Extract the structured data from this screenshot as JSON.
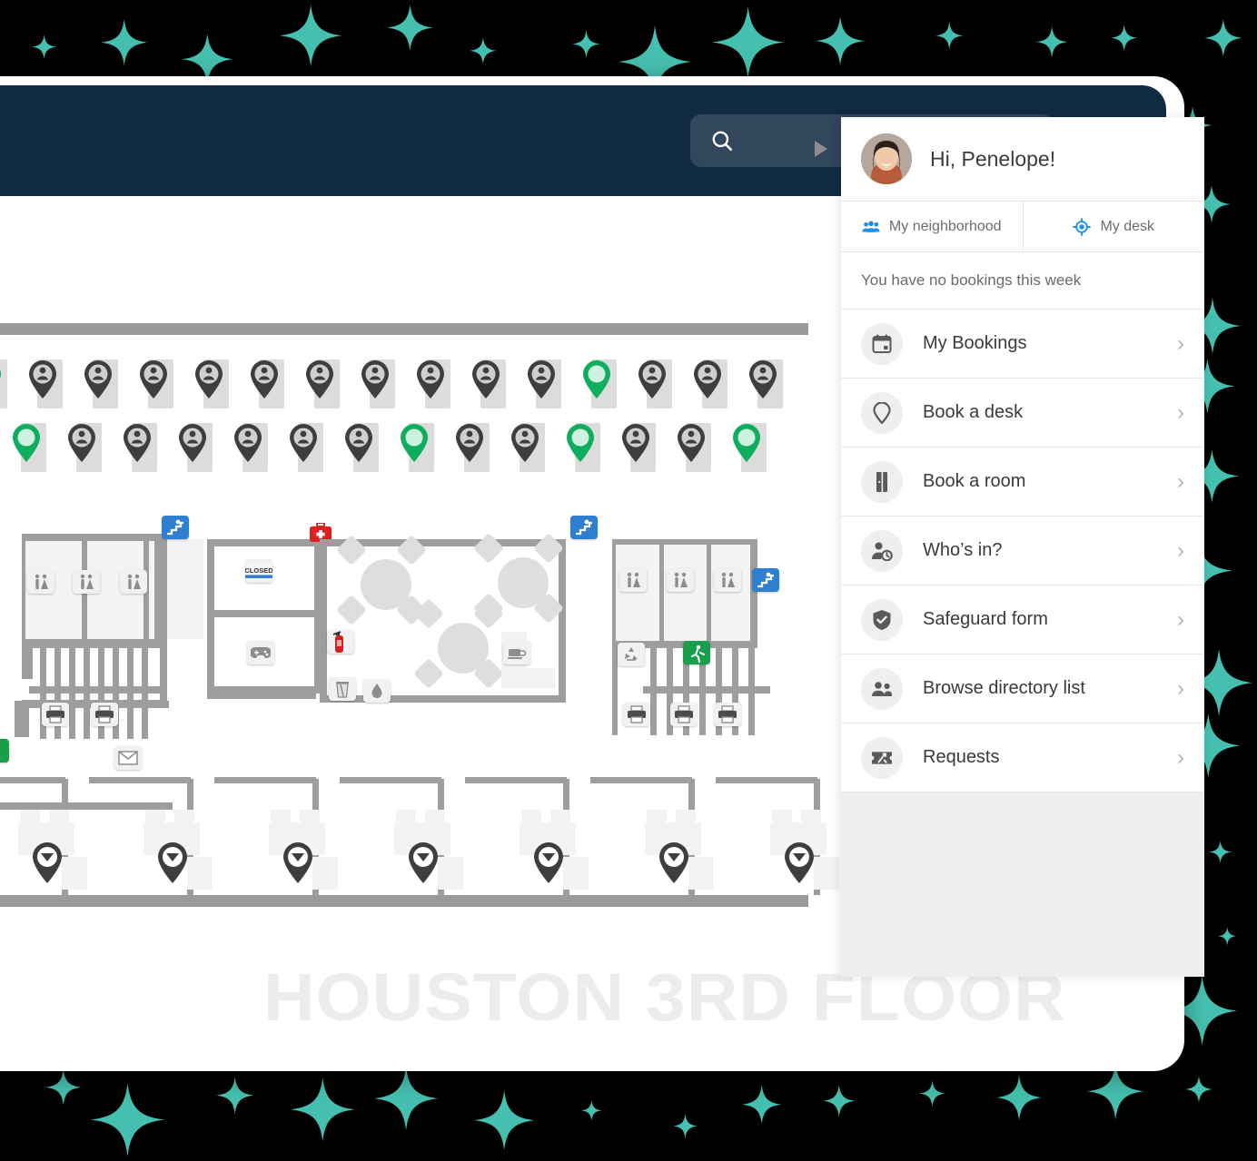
{
  "app": {
    "background_color": "#000000",
    "sparkle_color": "#45bfaf",
    "header_color": "#122b44",
    "accent_blue": "#1e90e8",
    "available_green": "#0fae5e",
    "occupied_gray": "#3e3e3e"
  },
  "header": {
    "search": {
      "value": "",
      "placeholder": "",
      "icon": "search-icon"
    },
    "menu_icon": "hamburger-menu-icon"
  },
  "map": {
    "floor_title": "HOUSTON 3RD FLOOR",
    "desk_rows": [
      {
        "states": [
          "available",
          "occupied",
          "occupied",
          "occupied",
          "occupied",
          "occupied",
          "occupied",
          "occupied",
          "occupied",
          "occupied",
          "occupied",
          "available",
          "occupied",
          "occupied",
          "occupied"
        ]
      },
      {
        "states": [
          "occupied",
          "available",
          "occupied",
          "occupied",
          "occupied",
          "occupied",
          "occupied",
          "occupied",
          "available",
          "occupied",
          "occupied",
          "available",
          "occupied",
          "occupied",
          "available"
        ]
      }
    ],
    "amenity_icons": [
      "stairs-icon",
      "first-aid-kit-icon",
      "closed-sign-icon",
      "fire-extinguisher-icon",
      "game-controller-icon",
      "coffee-icon",
      "drink-icon",
      "water-drop-icon",
      "restroom-icon",
      "mail-icon",
      "printer-icon",
      "emergency-exit-icon",
      "recycling-icon",
      "running-exit-icon"
    ],
    "room_marker_count": 7
  },
  "panel": {
    "handle_icon": "expand-panel-triangle-icon",
    "greeting": "Hi, Penelope!",
    "avatar_alt": "user-avatar",
    "tabs": [
      {
        "label": "My neighborhood",
        "icon": "people-group-icon",
        "active": false
      },
      {
        "label": "My desk",
        "icon": "target-location-icon",
        "active": true
      }
    ],
    "booking_status": "You have no bookings this week",
    "menu": [
      {
        "label": "My Bookings",
        "icon": "calendar-icon"
      },
      {
        "label": "Book a desk",
        "icon": "map-pin-icon"
      },
      {
        "label": "Book a  room",
        "icon": "door-icon"
      },
      {
        "label": "Who’s in?",
        "icon": "person-clock-icon"
      },
      {
        "label": "Safeguard form",
        "icon": "shield-check-icon"
      },
      {
        "label": "Browse directory list",
        "icon": "people-icon"
      },
      {
        "label": "Requests",
        "icon": "ticket-icon"
      }
    ],
    "chevron": "›"
  }
}
